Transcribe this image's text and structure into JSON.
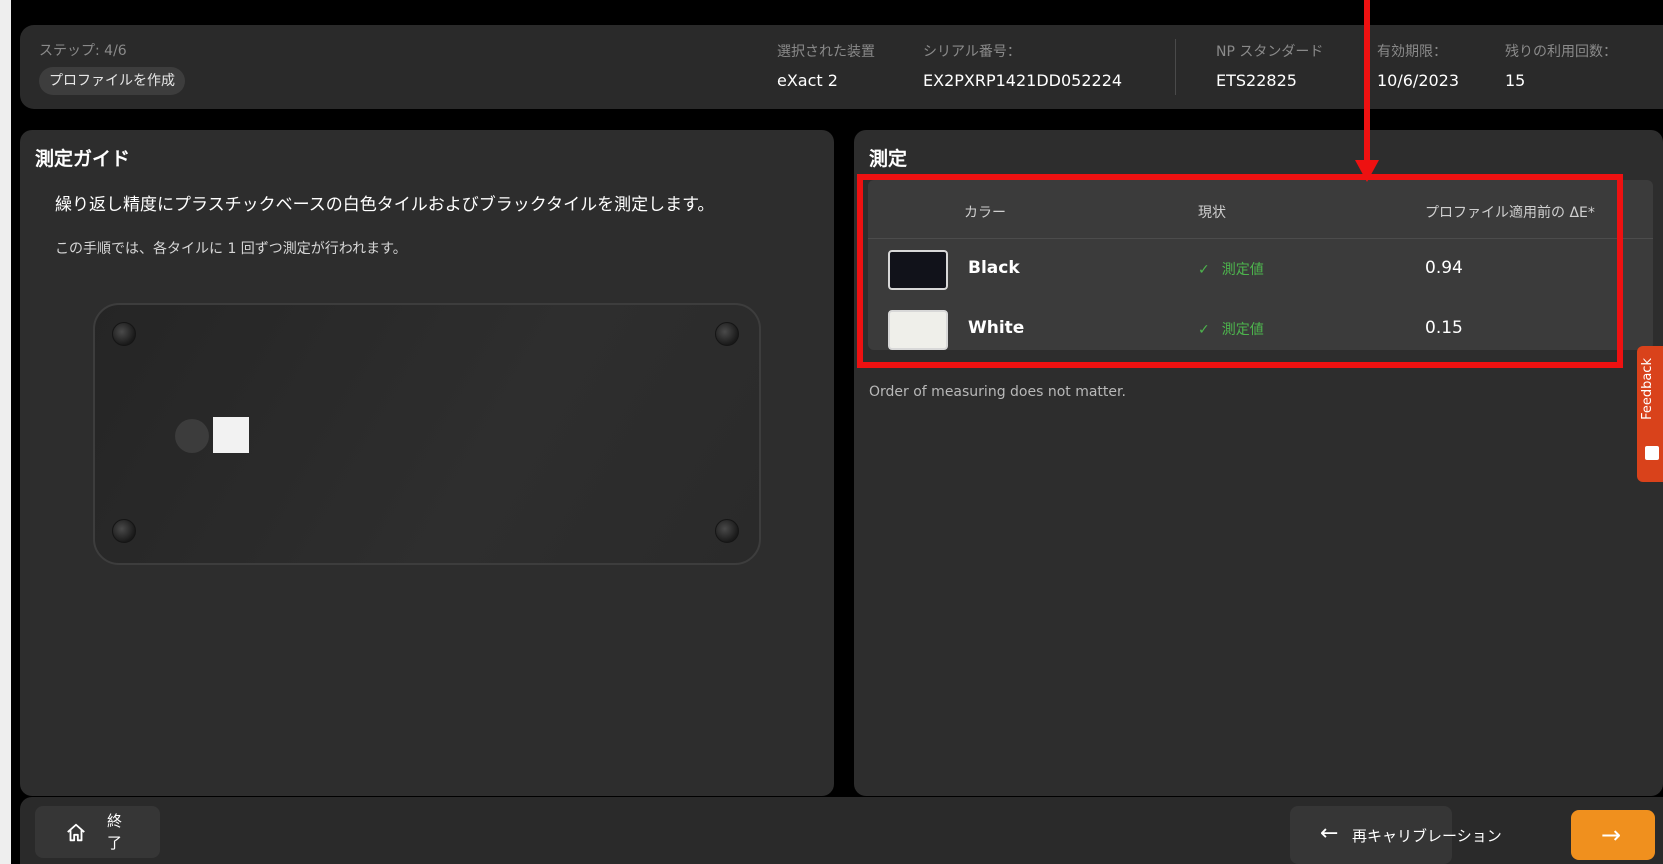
{
  "header": {
    "step": "ステップ: 4/6",
    "profile_chip": "プロファイルを作成",
    "selected_device_label": "選択された装置",
    "selected_device_value": "eXact 2",
    "serial_label": "シリアル番号：",
    "serial_value": "EX2PXRP1421DD052224",
    "standard_label": "NP スタンダード",
    "standard_value": "ETS22825",
    "expiry_label": "有効期限：",
    "expiry_value": "10/6/2023",
    "remaining_label": "残りの利用回数：",
    "remaining_value": "15"
  },
  "guide": {
    "title": "測定ガイド",
    "instruction": "繰り返し精度にプラスチックベースの白色タイルおよびブラックタイルを測定します。",
    "sub": "この手順では、各タイルに 1 回ずつ測定が行われます。"
  },
  "measure": {
    "title": "測定",
    "columns": [
      "カラー",
      "現状",
      "プロファイル適用前の ΔE*"
    ],
    "rows": [
      {
        "color": "Black",
        "swatch": "#11121a",
        "status": "測定値",
        "delta": "0.94"
      },
      {
        "color": "White",
        "swatch": "#efefea",
        "status": "測定値",
        "delta": "0.15"
      }
    ],
    "note": "Order of measuring does not matter."
  },
  "feedback": {
    "label": "Feedback"
  },
  "footer": {
    "home_label": "終了",
    "recalibrate_label": "再キャリブレーション",
    "next_icon": "arrow-right-icon"
  },
  "colors": {
    "accent": "#f0901e",
    "annotation": "#ee1111",
    "success": "#4db34d",
    "feedback": "#d9421b"
  }
}
